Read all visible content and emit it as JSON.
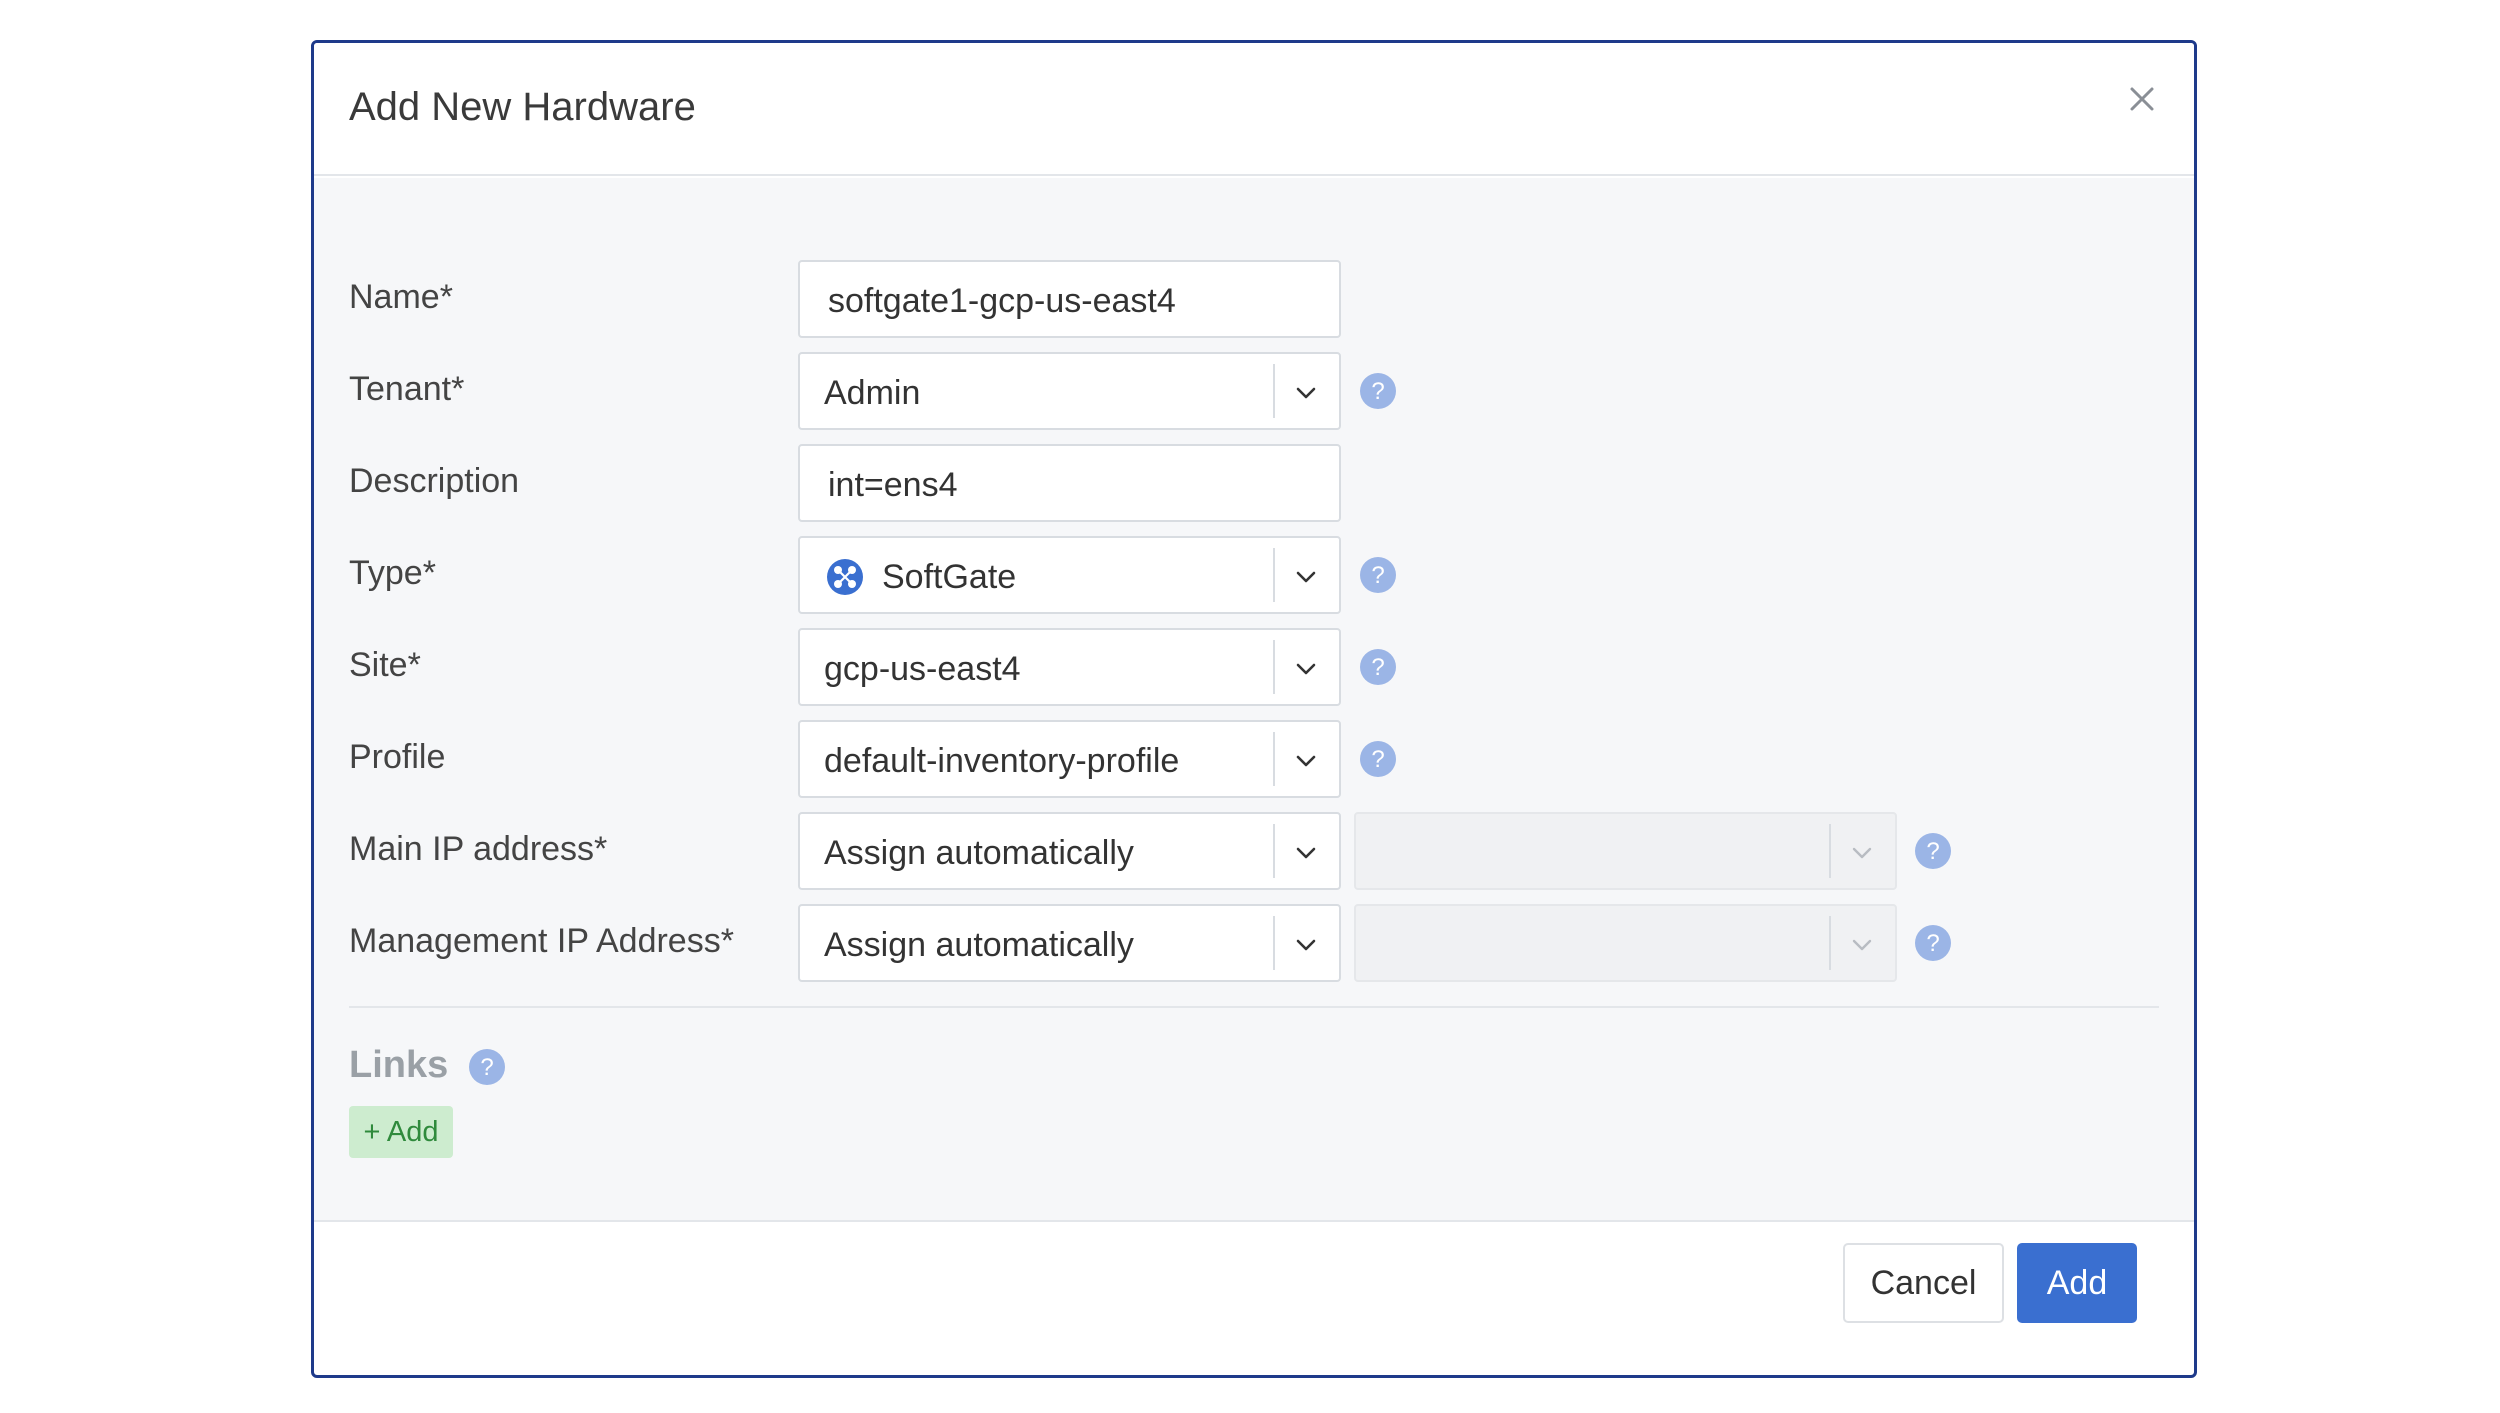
{
  "dialog": {
    "title": "Add New Hardware",
    "close_icon": "close-icon"
  },
  "form": {
    "name": {
      "label": "Name*",
      "value": "softgate1-gcp-us-east4"
    },
    "tenant": {
      "label": "Tenant*",
      "value": "Admin"
    },
    "description": {
      "label": "Description",
      "value": "int=ens4"
    },
    "type": {
      "label": "Type*",
      "value": "SoftGate",
      "icon": "softgate-icon"
    },
    "site": {
      "label": "Site*",
      "value": "gcp-us-east4"
    },
    "profile": {
      "label": "Profile",
      "value": "default-inventory-profile"
    },
    "main_ip": {
      "label": "Main IP address*",
      "value": "Assign automatically",
      "secondary_value": ""
    },
    "management_ip": {
      "label": "Management IP Address*",
      "value": "Assign automatically",
      "secondary_value": ""
    }
  },
  "links": {
    "title": "Links",
    "add_label": "+ Add"
  },
  "footer": {
    "cancel_label": "Cancel",
    "add_label": "Add"
  },
  "colors": {
    "primary": "#3a6fd0",
    "help_icon": "#9bb5e6",
    "links_add_bg": "#cdeccf",
    "links_add_text": "#2f8a3c",
    "dialog_border": "#1e3a8a"
  }
}
